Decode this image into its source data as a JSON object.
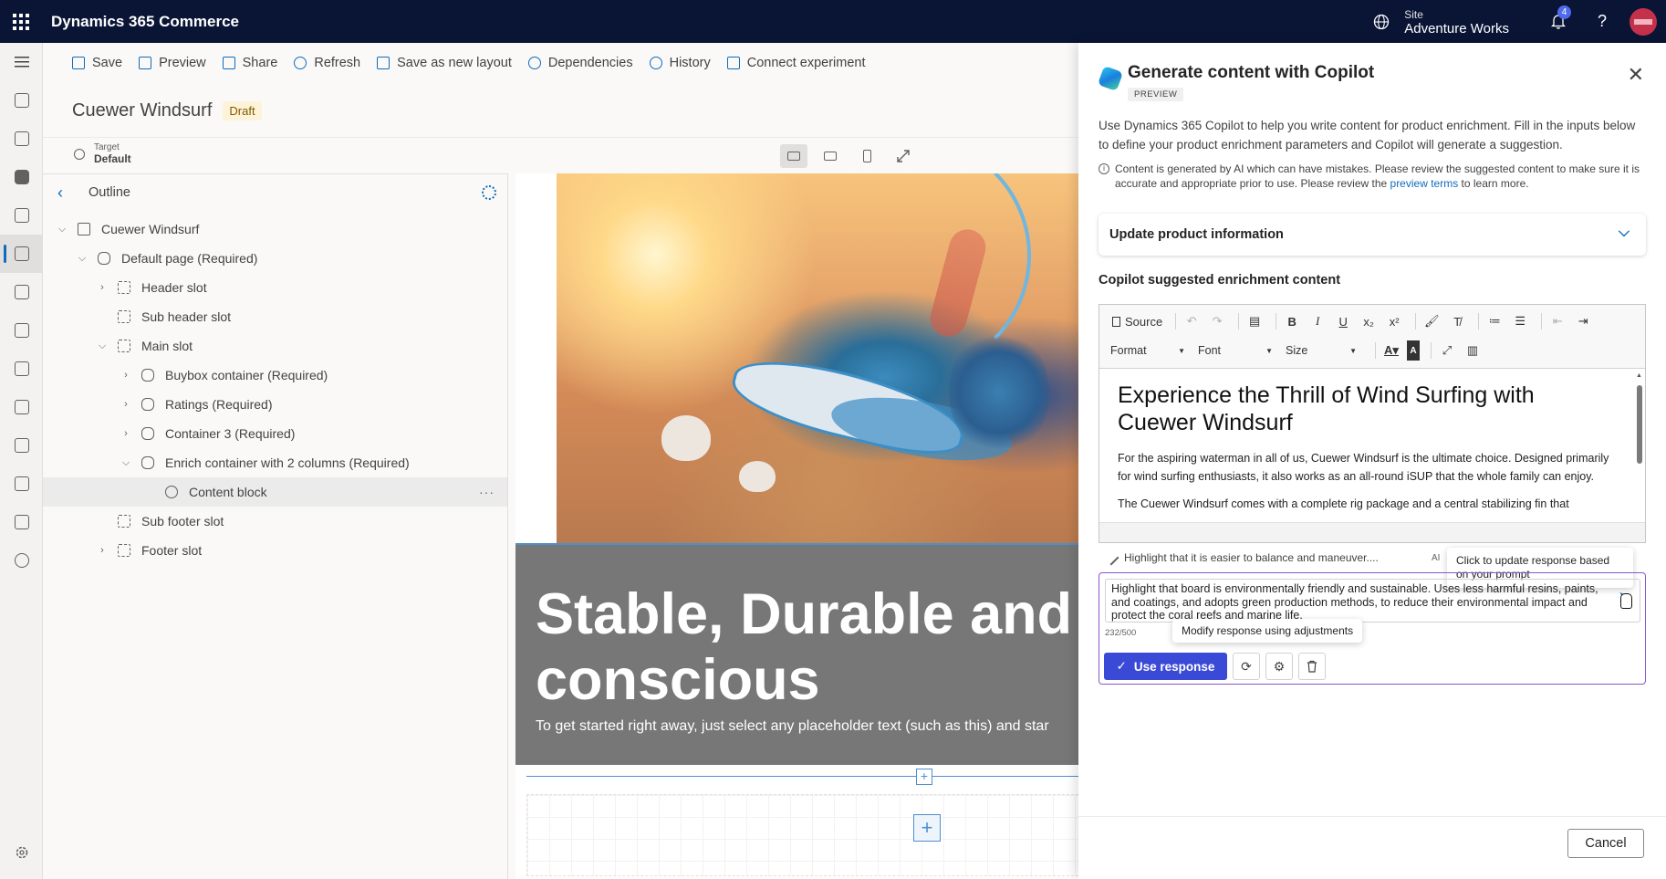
{
  "topbar": {
    "app_title": "Dynamics 365 Commerce",
    "site_label": "Site",
    "site_name": "Adventure Works",
    "notification_count": "4",
    "help": "?"
  },
  "commands": [
    {
      "label": "Save",
      "icon": "save-icon"
    },
    {
      "label": "Preview",
      "icon": "preview-icon"
    },
    {
      "label": "Share",
      "icon": "share-icon"
    },
    {
      "label": "Refresh",
      "icon": "refresh-icon"
    },
    {
      "label": "Save as new layout",
      "icon": "layout-icon"
    },
    {
      "label": "Dependencies",
      "icon": "dependencies-icon"
    },
    {
      "label": "History",
      "icon": "history-icon"
    },
    {
      "label": "Connect experiment",
      "icon": "flask-icon"
    }
  ],
  "page": {
    "title": "Cuewer Windsurf",
    "status": "Draft",
    "target_label": "Target",
    "target_value": "Default"
  },
  "outline": {
    "title": "Outline",
    "items": [
      {
        "label": "Cuewer Windsurf"
      },
      {
        "label": "Default page (Required)"
      },
      {
        "label": "Header slot"
      },
      {
        "label": "Sub header slot"
      },
      {
        "label": "Main slot"
      },
      {
        "label": "Buybox container (Required)"
      },
      {
        "label": "Ratings (Required)"
      },
      {
        "label": "Container 3 (Required)"
      },
      {
        "label": "Enrich container with 2 columns (Required)"
      },
      {
        "label": "Content block"
      },
      {
        "label": "Sub footer slot"
      },
      {
        "label": "Footer slot"
      }
    ],
    "more": "···"
  },
  "canvas": {
    "heading_line1": "Stable, Durable and",
    "heading_line2": "conscious",
    "subtext": "To get started right away, just select any placeholder text (such as this) and star",
    "add_small": "+",
    "add_big": "+"
  },
  "copilot": {
    "title": "Generate content with Copilot",
    "preview_tag": "PREVIEW",
    "description": "Use Dynamics 365 Copilot to help you write content for product enrichment. Fill in the inputs below to define your product enrichment parameters and Copilot will generate a suggestion.",
    "info_before": "Content is generated by AI which can have mistakes. Please review the suggested content to make sure it is accurate and appropriate prior to use. Please review the ",
    "info_link": "preview terms",
    "info_after": " to learn more.",
    "accordion_label": "Update product information",
    "section_label": "Copilot suggested enrichment content",
    "toolbar": {
      "source": "Source",
      "format": "Format",
      "font": "Font",
      "size": "Size"
    },
    "editor": {
      "heading": "Experience the Thrill of Wind Surfing with Cuewer Windsurf",
      "para1": "For the aspiring waterman in all of us, Cuewer Windsurf is the ultimate choice. Designed primarily for wind surfing enthusiasts, it also works as an all-round iSUP that the whole family can enjoy.",
      "para2": "The Cuewer Windsurf comes with a complete rig package and a central stabilizing fin that"
    },
    "prompt_hint": "Highlight that it is easier to balance and maneuver....",
    "ai_small": "AI",
    "tooltip_prompt": "Click to update response based on your prompt",
    "prompt_text": "Highlight that board is environmentally friendly and sustainable. Uses less harmful resins, paints, and coatings, and adopts green production methods, to reduce their environmental impact and protect the coral reefs and marine life.",
    "char_count": "232/500",
    "tooltip_modify": "Modify response using adjustments",
    "use_response": "Use response",
    "cancel": "Cancel"
  },
  "colors": {
    "topbar": "#0a1536",
    "accent": "#0f6cbd",
    "use_button": "#3a4ad6",
    "prompt_border": "#8a58c7"
  }
}
